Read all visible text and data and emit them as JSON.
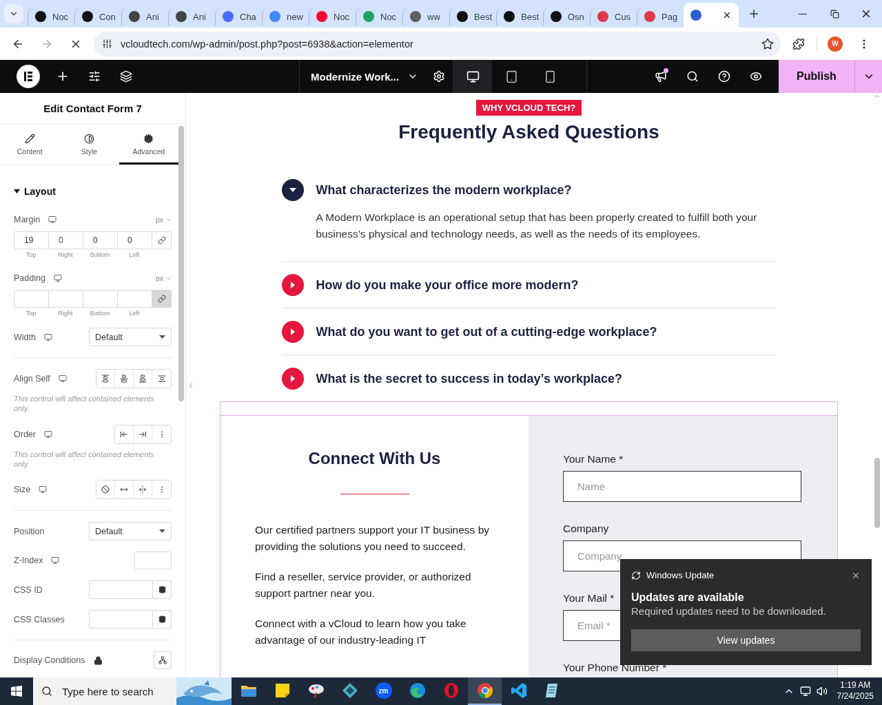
{
  "browser": {
    "tabs": [
      {
        "title": "Noc",
        "color": "#111111",
        "selected": false
      },
      {
        "title": "Con",
        "color": "#111111",
        "selected": false
      },
      {
        "title": "Ani",
        "color": "#444444",
        "selected": false
      },
      {
        "title": "Ani",
        "color": "#444444",
        "selected": false
      },
      {
        "title": "Cha",
        "color": "#4d6bfe",
        "selected": false
      },
      {
        "title": "new",
        "color": "#4285f4",
        "selected": false
      },
      {
        "title": "Noc",
        "color": "#ff0033",
        "selected": false
      },
      {
        "title": "Noc",
        "color": "#21a366",
        "selected": false
      },
      {
        "title": "ww",
        "color": "#5e5e5e",
        "selected": false
      },
      {
        "title": "Best",
        "color": "#0f0f0f",
        "selected": false
      },
      {
        "title": "Best",
        "color": "#0f0f0f",
        "selected": false
      },
      {
        "title": "Osn",
        "color": "#111111",
        "selected": false
      },
      {
        "title": "Cus",
        "color": "#e0384b",
        "selected": false
      },
      {
        "title": "Pag",
        "color": "#e0384b",
        "selected": false
      },
      {
        "color": "#2f5fd0",
        "selected": true
      }
    ],
    "url": "vcloudtech.com/wp-admin/post.php?post=6938&action=elementor",
    "profile_initial": "W"
  },
  "editor": {
    "document_title": "Modernize Work...",
    "devices": [
      {
        "kind": "desktop",
        "selected": true
      },
      {
        "kind": "tablet",
        "selected": false
      },
      {
        "kind": "mobile",
        "selected": false
      }
    ],
    "notification_dot": true,
    "publish_label": "Publish"
  },
  "panel": {
    "title": "Edit Contact Form 7",
    "tabs": [
      {
        "kind": "content",
        "label": "Content",
        "selected": false
      },
      {
        "kind": "style",
        "label": "Style",
        "selected": false
      },
      {
        "kind": "advanced",
        "label": "Advanced",
        "selected": true
      }
    ],
    "section": {
      "title": "Layout",
      "expanded": true
    },
    "controls": [
      {
        "kind": "dimensions",
        "label": "Margin",
        "responsive": true,
        "unit": "px",
        "values": [
          "19",
          "0",
          "0",
          "0"
        ],
        "sides": [
          "Top",
          "Right",
          "Bottom",
          "Left"
        ],
        "linked": false
      },
      {
        "kind": "dimensions",
        "label": "Padding",
        "responsive": true,
        "unit": "px",
        "sides": [
          "Top",
          "Right",
          "Bottom",
          "Left"
        ],
        "linked": true
      },
      {
        "kind": "select",
        "label": "Width",
        "responsive": true,
        "value": "Default"
      },
      {
        "kind": "divider"
      },
      {
        "kind": "buttons",
        "label": "Align Self",
        "responsive": true,
        "buttons": [
          {
            "kind": "align-start"
          },
          {
            "kind": "align-center"
          },
          {
            "kind": "align-end"
          },
          {
            "kind": "stretch"
          }
        ],
        "note": "This control will affect contained elements only."
      },
      {
        "kind": "buttons",
        "label": "Order",
        "responsive": true,
        "buttons": [
          {
            "kind": "start"
          },
          {
            "kind": "end"
          },
          {
            "kind": "more"
          }
        ],
        "note": "This control will affect contained elements only."
      },
      {
        "kind": "buttons",
        "label": "Size",
        "responsive": true,
        "buttons": [
          {
            "kind": "none"
          },
          {
            "kind": "grow"
          },
          {
            "kind": "shrink"
          },
          {
            "kind": "more"
          }
        ]
      },
      {
        "kind": "divider"
      },
      {
        "kind": "select",
        "label": "Position",
        "value": "Default"
      },
      {
        "kind": "number",
        "label": "Z-Index",
        "responsive": true
      },
      {
        "kind": "dynamic",
        "label": "CSS ID"
      },
      {
        "kind": "dynamic",
        "label": "CSS Classes"
      },
      {
        "kind": "divider"
      },
      {
        "kind": "conditions",
        "label": "Display Conditions",
        "locked": true
      }
    ]
  },
  "canvas": {
    "faq": {
      "badge": "WHY VCLOUD TECH?",
      "title": "Frequently Asked Questions",
      "items": [
        {
          "question": "What characterizes the modern workplace?",
          "expanded": true,
          "answer": "A Modern Workplace is an operational setup that has been properly created to fulfill both your business’s physical and technology needs, as well as the needs of its employees."
        },
        {
          "question": "How do you make your office more modern?",
          "expanded": false
        },
        {
          "question": "What do you want to get out of a cutting-edge workplace?",
          "expanded": false
        },
        {
          "question": "What is the secret to success in today’s workplace?",
          "expanded": false
        }
      ]
    },
    "contact": {
      "selected": true,
      "title": "Connect With Us",
      "paragraphs": [
        "Our certified partners support your IT business by providing the solutions you need to succeed.",
        "Find a reseller, service provider, or authorized support partner near you.",
        "Connect with a vCloud to learn how you take advantage of our industry-leading IT"
      ],
      "fields": [
        {
          "label": "Your Name *",
          "placeholder": "Name"
        },
        {
          "label": "Company",
          "placeholder": "Company"
        },
        {
          "label": "Your Mail *",
          "placeholder": "Email *"
        },
        {
          "label": "Your Phone Number *"
        }
      ]
    }
  },
  "notification": {
    "app": "Windows Update",
    "title": "Updates are available",
    "body": "Required updates need to be downloaded.",
    "action": "View updates"
  },
  "taskbar": {
    "search_placeholder": "Type here to search",
    "apps": [
      {
        "kind": "explorer",
        "selected": false
      },
      {
        "kind": "notes",
        "selected": false
      },
      {
        "kind": "paint",
        "selected": false
      },
      {
        "kind": "diamond",
        "selected": false
      },
      {
        "kind": "zoom",
        "label": "zm",
        "selected": false
      },
      {
        "kind": "edge",
        "selected": false
      },
      {
        "kind": "opera",
        "selected": false
      },
      {
        "kind": "chrome",
        "selected": true
      },
      {
        "kind": "vscode",
        "selected": false
      },
      {
        "kind": "notepad",
        "selected": false
      }
    ],
    "time": "1:19 AM",
    "date": "7/24/2025"
  }
}
